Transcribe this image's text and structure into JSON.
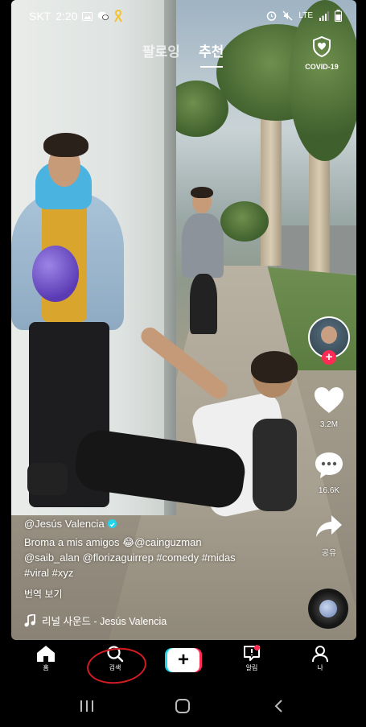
{
  "status_bar": {
    "carrier": "SKT",
    "time": "2:20",
    "network": "LTE"
  },
  "top_tabs": {
    "following": "팔로잉",
    "for_you": "추천",
    "active": "추천"
  },
  "covid_button": {
    "label": "COVID-19",
    "icon": "shield-heart-icon"
  },
  "actions": {
    "like_count": "3.2M",
    "comment_count": "16.6K",
    "share_label": "공유"
  },
  "post": {
    "username": "@Jesús Valencia",
    "description_line1": "Broma a mis amigos 😂@cainguzman",
    "description_line2": "@saib_alan @florizaguirrep #comedy #midas",
    "description_line3": "#viral #xyz",
    "see_translation": "번역 보기",
    "music": "리널 사운드 - Jesús Valencia"
  },
  "bottom_nav": {
    "home": "홈",
    "discover": "검색",
    "inbox": "알림",
    "profile": "나"
  },
  "colors": {
    "accent_red": "#fe2c55",
    "accent_cyan": "#20d5ec",
    "annotation_red": "#d21c22"
  }
}
